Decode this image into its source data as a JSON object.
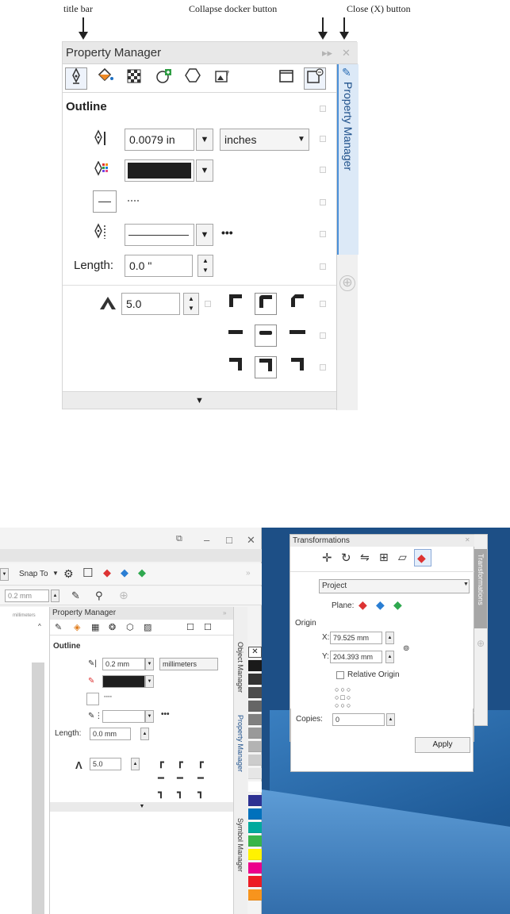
{
  "callouts": {
    "title_bar": "title bar",
    "collapse": "Collapse docker button",
    "close": "Close (X) button"
  },
  "docker": {
    "title": "Property Manager",
    "collapse_icon": "▸▸",
    "close_icon": "✕",
    "vertical_tab": "Property Manager",
    "vertical_tab_icon": "pen-icon",
    "add_tab_icon": "⊕",
    "toolbar_icons": [
      "outline-pen-icon",
      "fill-bucket-icon",
      "transparency-icon",
      "effects-icon",
      "polygon-icon",
      "image-icon",
      "frame-icon",
      "link-frame-icon"
    ],
    "section_title": "Outline",
    "width_value": "0.0079 in",
    "units_value": "inches",
    "length_label": "Length:",
    "length_value": "0.0 \"",
    "miter_value": "5.0",
    "more_icon": "•••",
    "scroll_icon": "▼"
  },
  "screenshot": {
    "snap_label": "Snap To",
    "size_value": "0.2 mm",
    "ruler_units": "millimeters",
    "pm_title": "Property Manager",
    "pm_section": "Outline",
    "pm_width": "0.2 mm",
    "pm_units": "millimeters",
    "pm_length_label": "Length:",
    "pm_length_value": "0.0 mm",
    "pm_miter": "5.0",
    "tab_object": "Object Manager",
    "tab_property": "Property Manager",
    "tab_symbol": "Symbol Manager",
    "transformations": {
      "title": "Transformations",
      "mode": "Project",
      "plane_label": "Plane:",
      "origin_label": "Origin",
      "x_label": "X:",
      "x_value": "79.525 mm",
      "y_label": "Y:",
      "y_value": "204.393 mm",
      "relative_origin": "Relative Origin",
      "copies_label": "Copies:",
      "copies_value": "0",
      "apply_label": "Apply",
      "vertical_tab": "Transformations"
    },
    "palette": [
      "#ffffff",
      "#1a1a1a",
      "#333333",
      "#4d4d4d",
      "#666666",
      "#808080",
      "#999999",
      "#b3b3b3",
      "#cccccc",
      "#e6e6e6",
      "#ffffff",
      "#2e3192",
      "#0071bc",
      "#00a99d",
      "#39b54a",
      "#fff200",
      "#ec008c",
      "#ed1c24",
      "#f7941d"
    ]
  }
}
